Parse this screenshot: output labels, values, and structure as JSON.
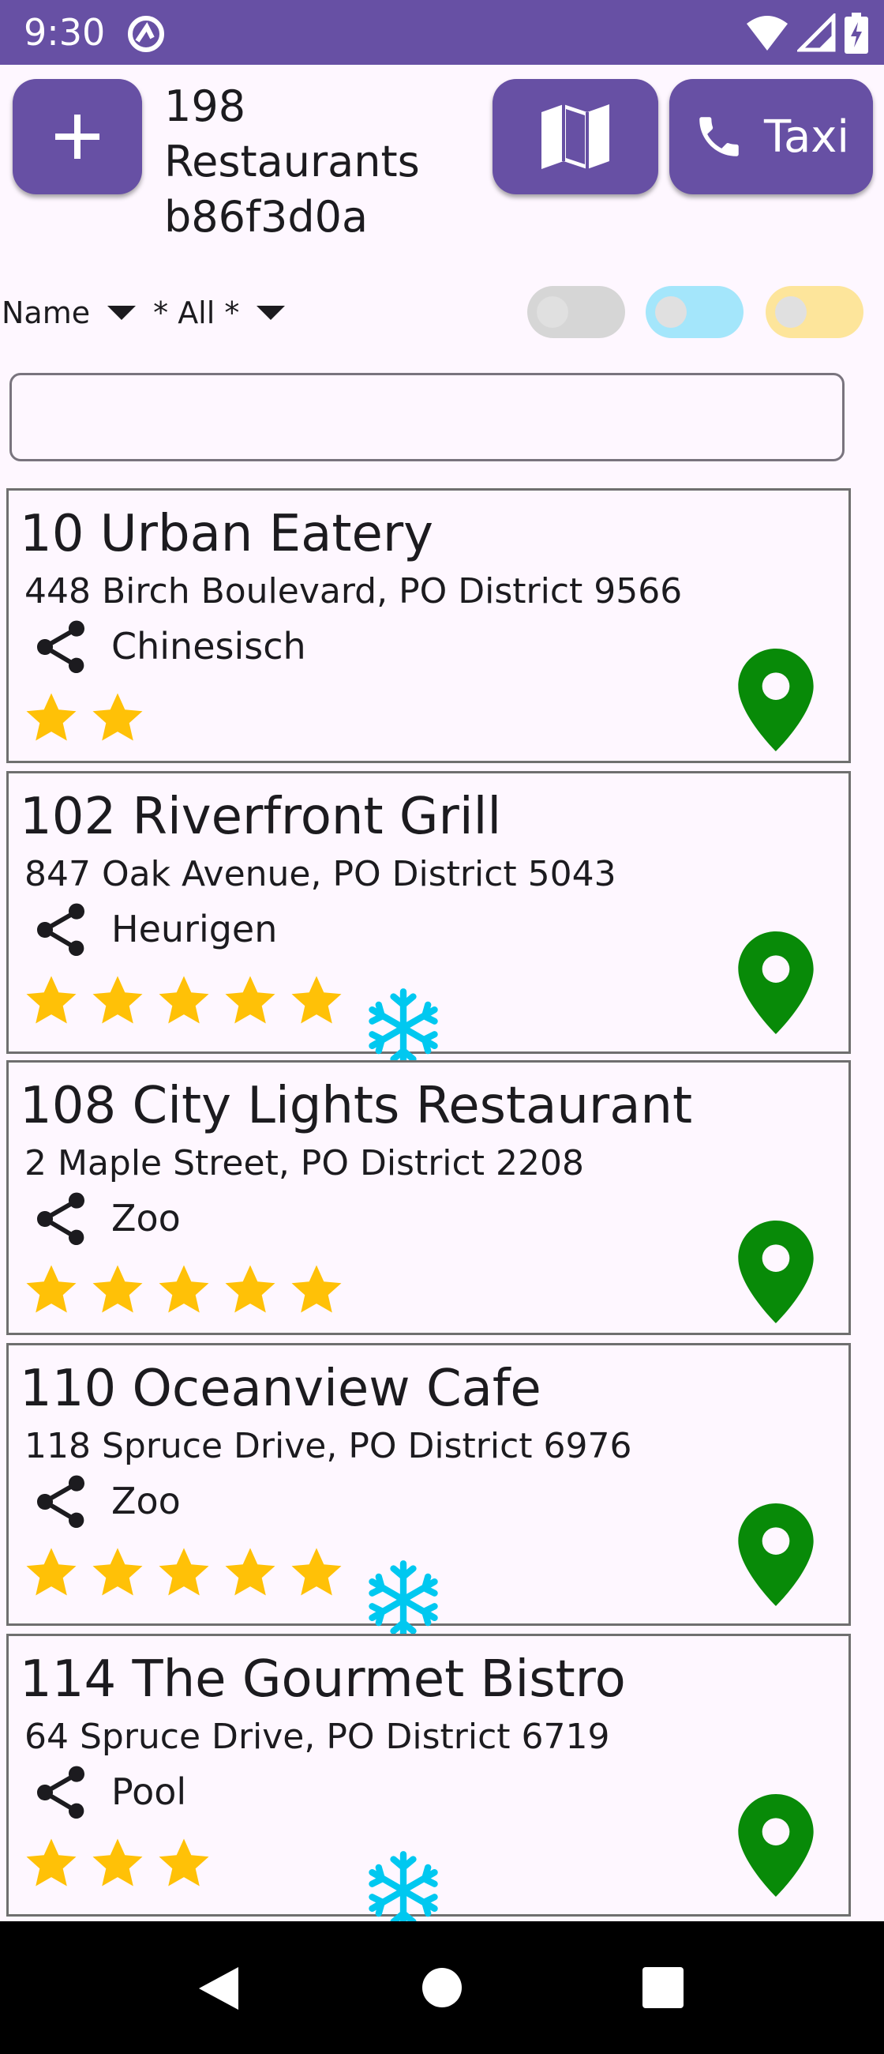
{
  "status_bar": {
    "time": "9:30"
  },
  "header": {
    "add_icon": "plus-icon",
    "count_line": "198",
    "label_line": "Restaurants",
    "id_line": "b86f3d0a",
    "map_icon": "map-icon",
    "taxi_icon": "phone-icon",
    "taxi_label": "Taxi"
  },
  "filters": {
    "sort_value": "Name",
    "category_value": "* All *",
    "toggle_colors": [
      "#D6D6D6",
      "#A4E6FB",
      "#FDE59B"
    ]
  },
  "search": {
    "value": ""
  },
  "colors": {
    "primary": "#6750A4",
    "star": "#FFC107",
    "pin": "#088A08",
    "snow": "#00C8F0"
  },
  "restaurants": [
    {
      "title": "10 Urban Eatery",
      "address": "448 Birch Boulevard, PO District 9566",
      "category": "Chinesisch",
      "rating": 2,
      "snow": false
    },
    {
      "title": "102 Riverfront Grill",
      "address": "847 Oak Avenue, PO District 5043",
      "category": "Heurigen",
      "rating": 5,
      "snow": true
    },
    {
      "title": "108 City Lights Restaurant",
      "address": "2 Maple Street, PO District 2208",
      "category": "Zoo",
      "rating": 5,
      "snow": false
    },
    {
      "title": "110 Oceanview Cafe",
      "address": "118 Spruce Drive, PO District 6976",
      "category": "Zoo",
      "rating": 5,
      "snow": true
    },
    {
      "title": "114 The Gourmet Bistro",
      "address": "64 Spruce Drive, PO District 6719",
      "category": "Pool",
      "rating": 3,
      "snow": true
    }
  ]
}
